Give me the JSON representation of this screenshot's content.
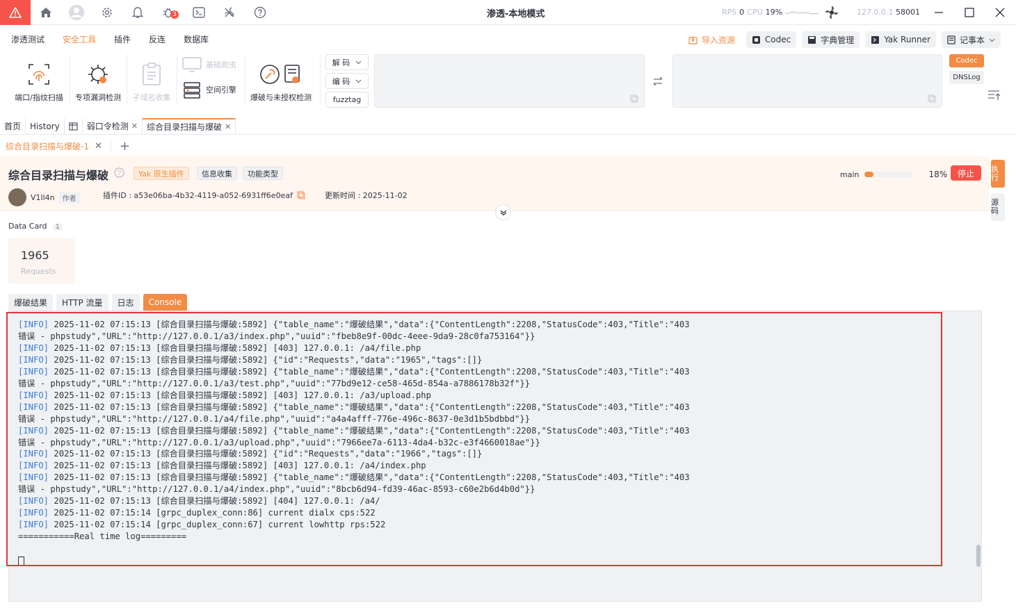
{
  "titlebar": {
    "title": "渗透-本地模式",
    "badge": "3",
    "rps_label": "RPS",
    "rps_value": "0",
    "cpu_label": "CPU",
    "cpu_value": "19%",
    "host": "127.0.0.1",
    "port": "58001"
  },
  "menu": {
    "items": [
      "渗透测试",
      "安全工具",
      "插件",
      "反连",
      "数据库"
    ],
    "active": "安全工具"
  },
  "right_buttons": {
    "import": "导入资源",
    "codec": "Codec",
    "dict": "字典管理",
    "runner": "Yak Runner",
    "notebook": "记事本"
  },
  "tools": {
    "port_scan": "端口/指纹扫描",
    "vuln": "专项漏洞检测",
    "subdomain": "子域名收集",
    "crawler": "基础爬虫",
    "space": "空间引擎",
    "brute": "爆破与未授权检测"
  },
  "codec": {
    "decode": "解 码",
    "encode": "编 码",
    "fuzztag": "fuzztag"
  },
  "side_buttons": {
    "codec": "Codec",
    "dnslog": "DNSLog"
  },
  "tabs1": [
    {
      "label": "首页"
    },
    {
      "label": "History"
    },
    {
      "label": "弱口令检测"
    },
    {
      "label": "综合目录扫描与爆破"
    }
  ],
  "subtab": {
    "label": "综合目录扫描与爆破-1"
  },
  "plugin": {
    "title": "综合目录扫描与爆破",
    "tags": [
      "Yak 原生插件",
      "信息收集",
      "功能类型"
    ],
    "author": "V1ll4n",
    "author_tag": "作者",
    "plugin_id_label": "插件ID : a53e06ba-4b32-4119-a052-6931ff6e0eaf",
    "updated": "更新时间 : 2025-11-02",
    "progress_label": "main",
    "progress": 18,
    "progress_text": "18%",
    "stop": "停止",
    "side_exec": "执行",
    "side_src": "源码"
  },
  "datacard": {
    "label": "Data Card",
    "count": "1",
    "value": "1965",
    "value_label": "Requests"
  },
  "result_tabs": [
    "爆破结果",
    "HTTP 流量",
    "日志",
    "Console"
  ],
  "active_result_tab": "Console",
  "colors": {
    "accent": "#f28b44",
    "danger": "#f6544a",
    "highlight_border": "#e8343a"
  },
  "console_lines": [
    "[INFO] 2025-11-02 07:15:13 [综合目录扫描与爆破:5892] {\"table_name\":\"爆破结果\",\"data\":{\"ContentLength\":2208,\"StatusCode\":403,\"Title\":\"403",
    "错误 - phpstudy\",\"URL\":\"http://127.0.0.1/a3/index.php\",\"uuid\":\"fbeb8e9f-00dc-4eee-9da9-28c0fa753164\"}}",
    "[INFO] 2025-11-02 07:15:13 [综合目录扫描与爆破:5892] [403] 127.0.0.1: /a4/file.php",
    "[INFO] 2025-11-02 07:15:13 [综合目录扫描与爆破:5892] {\"id\":\"Requests\",\"data\":\"1965\",\"tags\":[]}",
    "[INFO] 2025-11-02 07:15:13 [综合目录扫描与爆破:5892] {\"table_name\":\"爆破结果\",\"data\":{\"ContentLength\":2208,\"StatusCode\":403,\"Title\":\"403",
    "错误 - phpstudy\",\"URL\":\"http://127.0.0.1/a3/test.php\",\"uuid\":\"77bd9e12-ce58-465d-854a-a7886178b32f\"}}",
    "[INFO] 2025-11-02 07:15:13 [综合目录扫描与爆破:5892] [403] 127.0.0.1: /a3/upload.php",
    "[INFO] 2025-11-02 07:15:13 [综合目录扫描与爆破:5892] {\"table_name\":\"爆破结果\",\"data\":{\"ContentLength\":2208,\"StatusCode\":403,\"Title\":\"403",
    "错误 - phpstudy\",\"URL\":\"http://127.0.0.1/a4/file.php\",\"uuid\":\"a4a4afff-776e-496c-8637-0e3d1b5bdbbd\"}}",
    "[INFO] 2025-11-02 07:15:13 [综合目录扫描与爆破:5892] {\"table_name\":\"爆破结果\",\"data\":{\"ContentLength\":2208,\"StatusCode\":403,\"Title\":\"403",
    "错误 - phpstudy\",\"URL\":\"http://127.0.0.1/a3/upload.php\",\"uuid\":\"7966ee7a-6113-4da4-b32c-e3f4660018ae\"}}",
    "[INFO] 2025-11-02 07:15:13 [综合目录扫描与爆破:5892] {\"id\":\"Requests\",\"data\":\"1966\",\"tags\":[]}",
    "[INFO] 2025-11-02 07:15:13 [综合目录扫描与爆破:5892] [403] 127.0.0.1: /a4/index.php",
    "[INFO] 2025-11-02 07:15:13 [综合目录扫描与爆破:5892] {\"table_name\":\"爆破结果\",\"data\":{\"ContentLength\":2208,\"StatusCode\":403,\"Title\":\"403",
    "错误 - phpstudy\",\"URL\":\"http://127.0.0.1/a4/index.php\",\"uuid\":\"8bcb6d94-fd39-46ac-8593-c60e2b6d4b0d\"}}",
    "[INFO] 2025-11-02 07:15:13 [综合目录扫描与爆破:5892] [404] 127.0.0.1: /a4/",
    "[INFO] 2025-11-02 07:15:14 [grpc_duplex_conn:86] current dialx cps:522",
    "[INFO] 2025-11-02 07:15:14 [grpc_duplex_conn:67] current lowhttp rps:522",
    "===========Real time log========="
  ]
}
